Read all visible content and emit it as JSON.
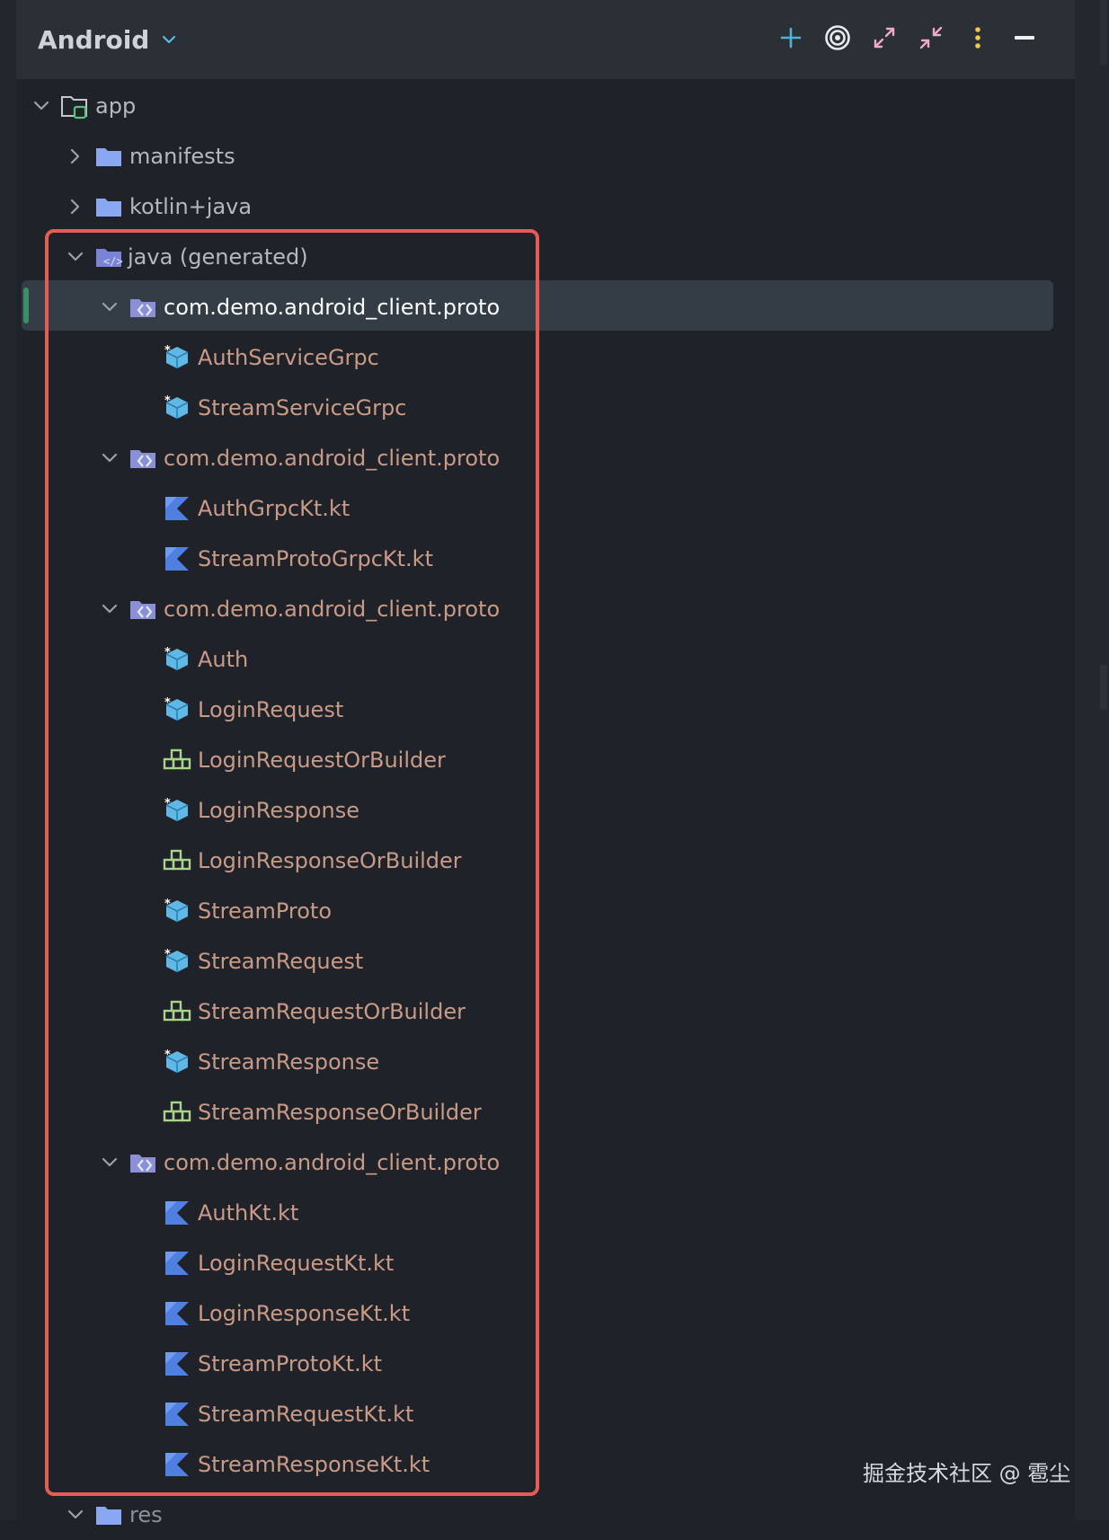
{
  "header": {
    "title": "Android",
    "toolbar": [
      {
        "name": "add-icon"
      },
      {
        "name": "locate-target-icon"
      },
      {
        "name": "expand-all-icon"
      },
      {
        "name": "collapse-all-icon"
      },
      {
        "name": "more-options-icon"
      },
      {
        "name": "minimize-icon"
      }
    ]
  },
  "tree": {
    "app": "app",
    "manifests": "manifests",
    "kotlin_java": "kotlin+java",
    "java_generated": "java (generated)",
    "packages": [
      {
        "label": "com.demo.android_client.proto",
        "selected": true,
        "children": [
          {
            "label": "AuthServiceGrpc",
            "icon": "class-icon"
          },
          {
            "label": "StreamServiceGrpc",
            "icon": "class-icon"
          }
        ]
      },
      {
        "label": "com.demo.android_client.proto",
        "selected": false,
        "children": [
          {
            "label": "AuthGrpcKt.kt",
            "icon": "kotlin-file-icon"
          },
          {
            "label": "StreamProtoGrpcKt.kt",
            "icon": "kotlin-file-icon"
          }
        ]
      },
      {
        "label": "com.demo.android_client.proto",
        "selected": false,
        "children": [
          {
            "label": "Auth",
            "icon": "class-icon"
          },
          {
            "label": "LoginRequest",
            "icon": "class-icon"
          },
          {
            "label": "LoginRequestOrBuilder",
            "icon": "interface-icon"
          },
          {
            "label": "LoginResponse",
            "icon": "class-icon"
          },
          {
            "label": "LoginResponseOrBuilder",
            "icon": "interface-icon"
          },
          {
            "label": "StreamProto",
            "icon": "class-icon"
          },
          {
            "label": "StreamRequest",
            "icon": "class-icon"
          },
          {
            "label": "StreamRequestOrBuilder",
            "icon": "interface-icon"
          },
          {
            "label": "StreamResponse",
            "icon": "class-icon"
          },
          {
            "label": "StreamResponseOrBuilder",
            "icon": "interface-icon"
          }
        ]
      },
      {
        "label": "com.demo.android_client.proto",
        "selected": false,
        "children": [
          {
            "label": "AuthKt.kt",
            "icon": "kotlin-file-icon"
          },
          {
            "label": "LoginRequestKt.kt",
            "icon": "kotlin-file-icon"
          },
          {
            "label": "LoginResponseKt.kt",
            "icon": "kotlin-file-icon"
          },
          {
            "label": "StreamProtoKt.kt",
            "icon": "kotlin-file-icon"
          },
          {
            "label": "StreamRequestKt.kt",
            "icon": "kotlin-file-icon"
          },
          {
            "label": "StreamResponseKt.kt",
            "icon": "kotlin-file-icon"
          }
        ]
      }
    ],
    "res": "res"
  },
  "watermark": "掘金技术社区 @ 雹尘",
  "colors": {
    "background": "#1f2329",
    "header": "#2b2f36",
    "selection": "#343c45",
    "highlight_box": "#e35d54",
    "generated_text": "#c99a86",
    "folder": "#8aa7f2",
    "class_icon": "#5fb8e6",
    "interface_icon": "#a7d48a",
    "kotlin_icon": "#4f7fe0"
  }
}
